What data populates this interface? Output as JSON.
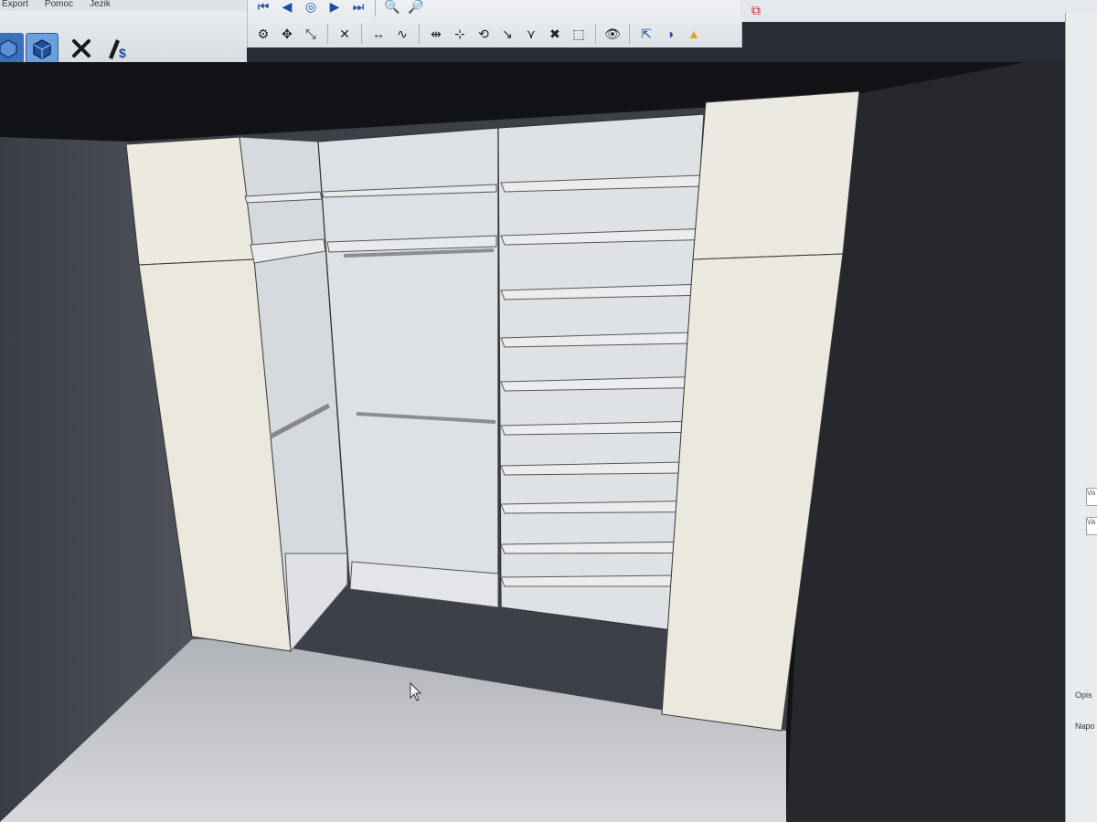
{
  "menu": {
    "items": [
      "Export",
      "Pomoc",
      "Jezik"
    ]
  },
  "toolbar": {
    "left_icons": [
      "cube-outline-icon",
      "cube-solid-icon",
      "tools-icon",
      "price-tag-icon"
    ],
    "row1_icons": [
      "first-icon",
      "back-icon",
      "target-icon",
      "forward-icon",
      "last-icon",
      "zoom-in-icon",
      "zoom-out-icon"
    ],
    "row2_icons": [
      "settings-icon",
      "move-icon",
      "transform-icon",
      "delete-line-icon",
      "distance-icon",
      "curve-icon",
      "dimension-icon",
      "add-point-icon",
      "rotate-icon",
      "arrow-icon",
      "node-icon",
      "close-icon",
      "select-frame-icon",
      "eye-icon",
      "export-icon",
      "shading-icon",
      "drive-icon"
    ],
    "accent": "#1d4f9e"
  },
  "right_panel": {
    "labels": [
      "Opis",
      "Napo"
    ],
    "fields": [
      "Va",
      "Va"
    ]
  },
  "viewport": {
    "panel_color": "#ecebe3",
    "interior_color": "#dcdfe3",
    "floor_color": "#c9cbd0"
  }
}
